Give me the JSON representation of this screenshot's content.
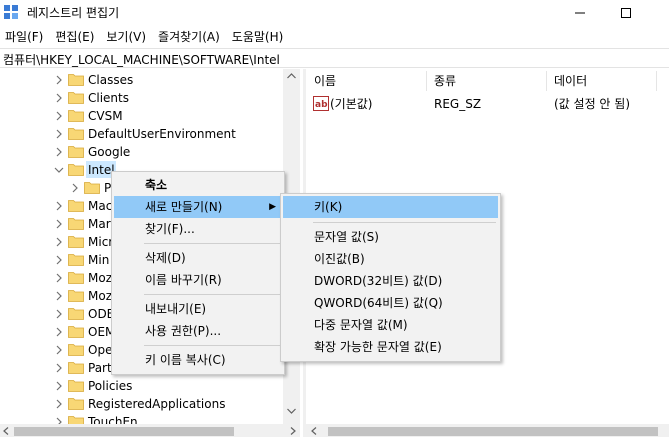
{
  "window": {
    "title": "레지스트리 편집기",
    "icon": "regedit-icon"
  },
  "menubar": {
    "items": [
      "파일(F)",
      "편집(E)",
      "보기(V)",
      "즐겨찾기(A)",
      "도움말(H)"
    ]
  },
  "address": {
    "path": "컴퓨터\\HKEY_LOCAL_MACHINE\\SOFTWARE\\Intel"
  },
  "tree": {
    "nodes": [
      {
        "label": "Classes"
      },
      {
        "label": "Clients"
      },
      {
        "label": "CVSM"
      },
      {
        "label": "DefaultUserEnvironment"
      },
      {
        "label": "Google"
      },
      {
        "label": "Intel",
        "expanded": true,
        "selected": true
      },
      {
        "label": "P"
      },
      {
        "label": "Mac"
      },
      {
        "label": "Mar"
      },
      {
        "label": "Micr"
      },
      {
        "label": "Min"
      },
      {
        "label": "Moz"
      },
      {
        "label": "Moz"
      },
      {
        "label": "ODE"
      },
      {
        "label": "OEM"
      },
      {
        "label": "Ope"
      },
      {
        "label": "Part"
      },
      {
        "label": "Policies"
      },
      {
        "label": "RegisteredApplications"
      },
      {
        "label": "TouchEn"
      }
    ]
  },
  "list": {
    "columns": [
      "이름",
      "종류",
      "데이터"
    ],
    "rows": [
      {
        "name": "(기본값)",
        "type": "REG_SZ",
        "data": "(값 설정 안 됨)"
      }
    ]
  },
  "context_menu": {
    "items": [
      {
        "label": "축소",
        "bold": true
      },
      {
        "label": "새로 만들기(N)",
        "submenu": true,
        "highlighted": true
      },
      {
        "label": "찾기(F)..."
      },
      {
        "label": "삭제(D)"
      },
      {
        "label": "이름 바꾸기(R)"
      },
      {
        "label": "내보내기(E)"
      },
      {
        "label": "사용 권한(P)..."
      },
      {
        "label": "키 이름 복사(C)"
      }
    ],
    "submenu_arrow": "▶"
  },
  "submenu": {
    "items": [
      {
        "label": "키(K)",
        "highlighted": true
      },
      {
        "label": "문자열 값(S)"
      },
      {
        "label": "이진값(B)"
      },
      {
        "label": "DWORD(32비트) 값(D)"
      },
      {
        "label": "QWORD(64비트) 값(Q)"
      },
      {
        "label": "다중 문자열 값(M)"
      },
      {
        "label": "확장 가능한 문자열 값(E)"
      }
    ]
  },
  "colors": {
    "highlight": "#91c9f7",
    "selection": "#cce8ff",
    "folder": "#f8d775",
    "menu_bg": "#f2f2f2"
  }
}
